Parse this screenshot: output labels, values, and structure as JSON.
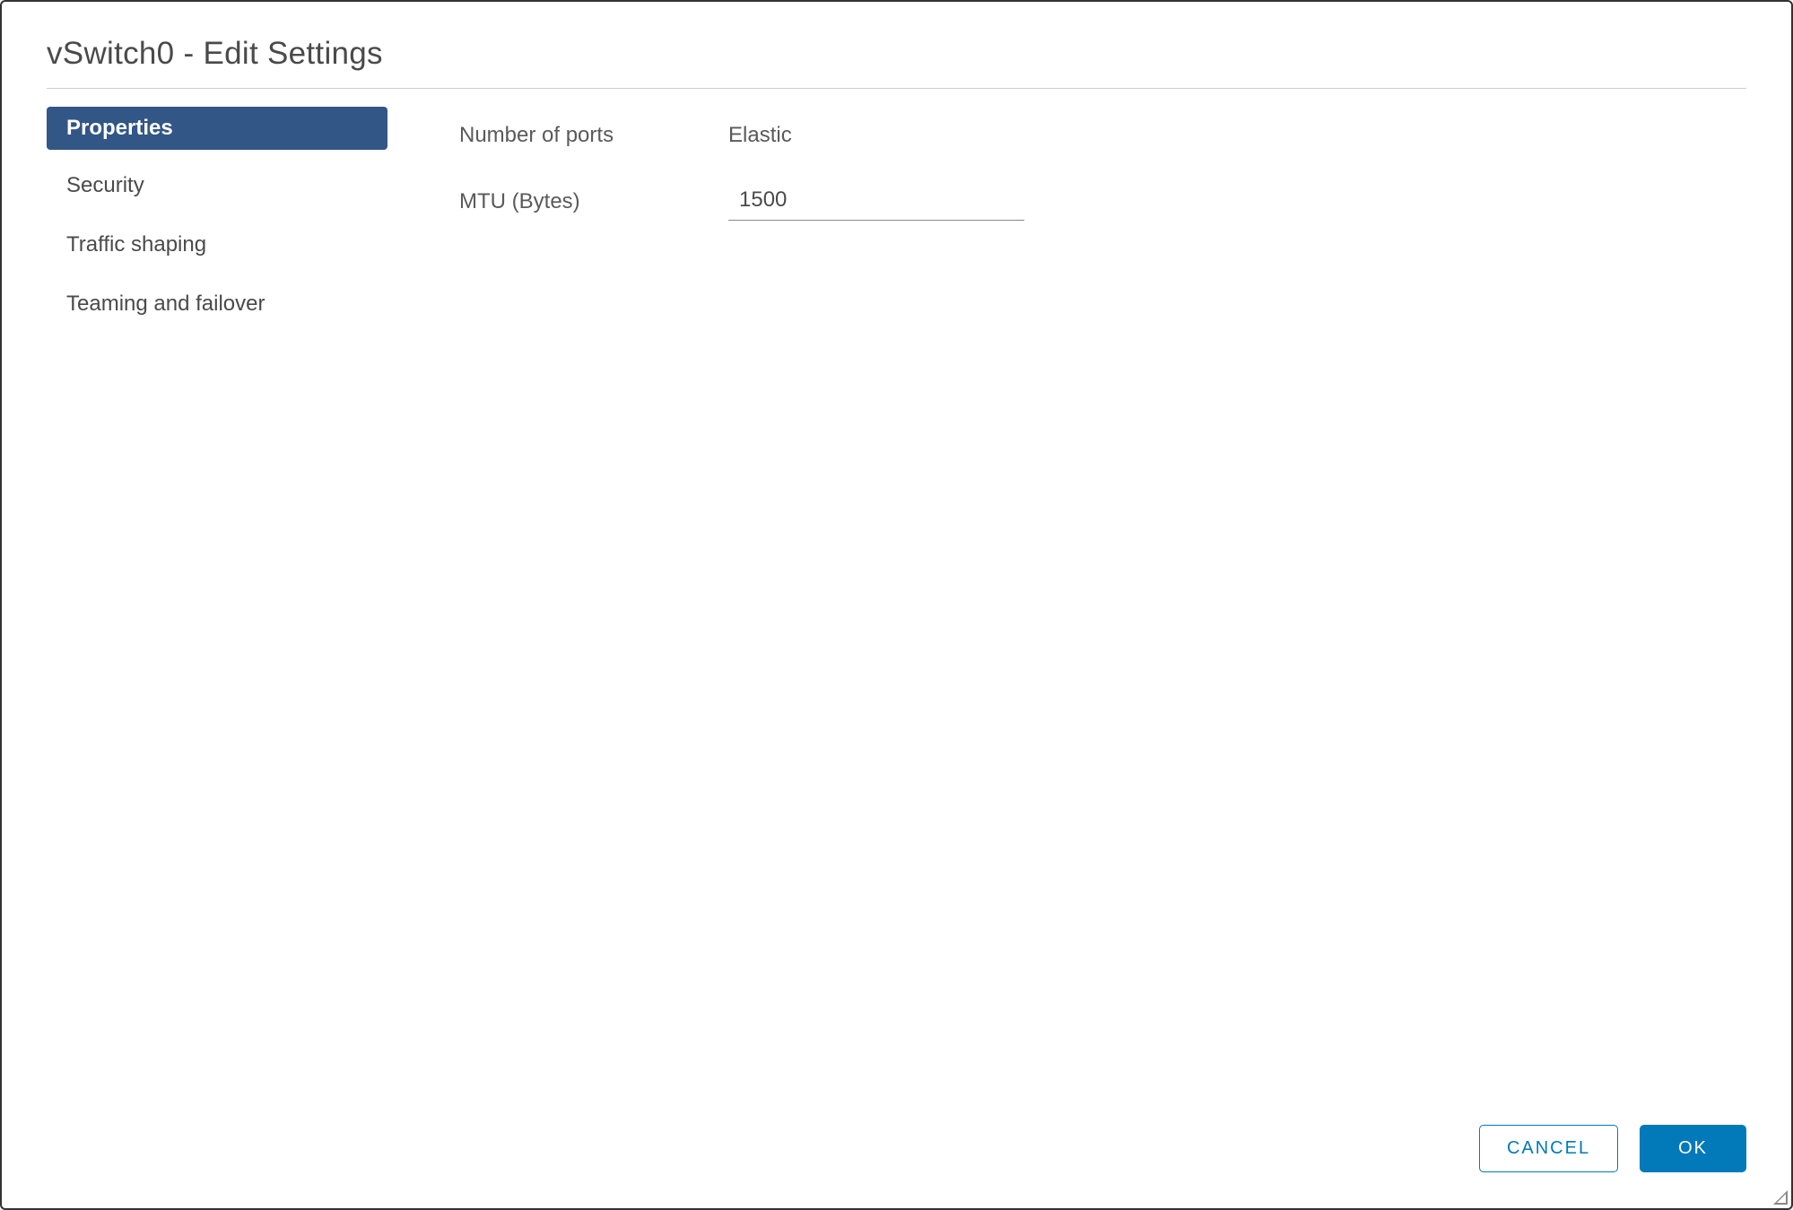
{
  "dialog": {
    "title": "vSwitch0 - Edit Settings"
  },
  "sidebar": {
    "items": [
      {
        "label": "Properties",
        "active": true
      },
      {
        "label": "Security",
        "active": false
      },
      {
        "label": "Traffic shaping",
        "active": false
      },
      {
        "label": "Teaming and failover",
        "active": false
      }
    ]
  },
  "content": {
    "ports": {
      "label": "Number of ports",
      "value": "Elastic"
    },
    "mtu": {
      "label": "MTU (Bytes)",
      "value": "1500"
    }
  },
  "footer": {
    "cancel_label": "CANCEL",
    "ok_label": "OK"
  }
}
